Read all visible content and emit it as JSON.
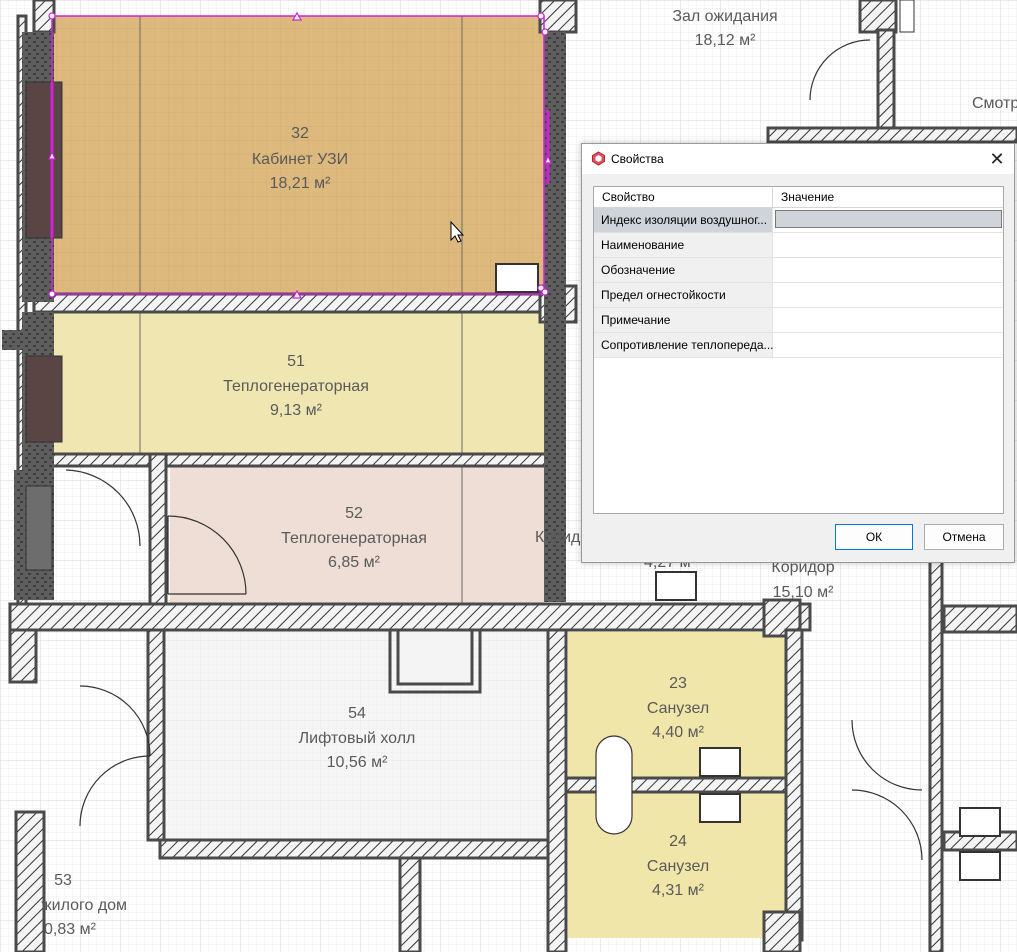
{
  "rooms": [
    {
      "number": "32",
      "name": "Кабинет УЗИ",
      "area": "18,21 м²"
    },
    {
      "number": "51",
      "name": "Теплогенераторная",
      "area": "9,13 м²"
    },
    {
      "number": "52",
      "name": "Теплогенераторная",
      "area": "6,85 м²"
    },
    {
      "number": "54",
      "name": "Лифтовый холл",
      "area": "10,56 м²"
    },
    {
      "number": "23",
      "name": "Санузел",
      "area": "4,40 м²"
    },
    {
      "number": "24",
      "name": "Санузел",
      "area": "4,31 м²"
    },
    {
      "number": "53",
      "name": "жилого дом",
      "area": "0,83 м²"
    }
  ],
  "partial_labels": {
    "waiting_name": "Зал ожидания",
    "waiting_area": "18,12 м²",
    "smotr": "Смотр",
    "koridor_cut": "Корид",
    "koridor_name": "Коридор",
    "koridor_area": "15,10 м²",
    "small_area": "4,27 м²"
  },
  "colors": {
    "room_32": "#ddb97e",
    "room_51": "#f0e6b2",
    "room_52": "#eeded5",
    "sanuzel": "#f0e6aa",
    "selection": "#d020d8",
    "wall": "#4a4a4a",
    "dialog_accent": "#0078d7"
  },
  "dialog": {
    "title": "Свойства",
    "icon": "app-cube-icon",
    "close": "✕",
    "columns": {
      "property": "Свойство",
      "value": "Значение"
    },
    "rows": [
      {
        "key": "Индекс изоляции воздушног...",
        "value": ""
      },
      {
        "key": "Наименование",
        "value": ""
      },
      {
        "key": "Обозначение",
        "value": ""
      },
      {
        "key": "Предел огнестойкости",
        "value": ""
      },
      {
        "key": "Примечание",
        "value": ""
      },
      {
        "key": "Сопротивление теплопереда...",
        "value": ""
      }
    ],
    "ok": "ОК",
    "cancel": "Отмена"
  }
}
